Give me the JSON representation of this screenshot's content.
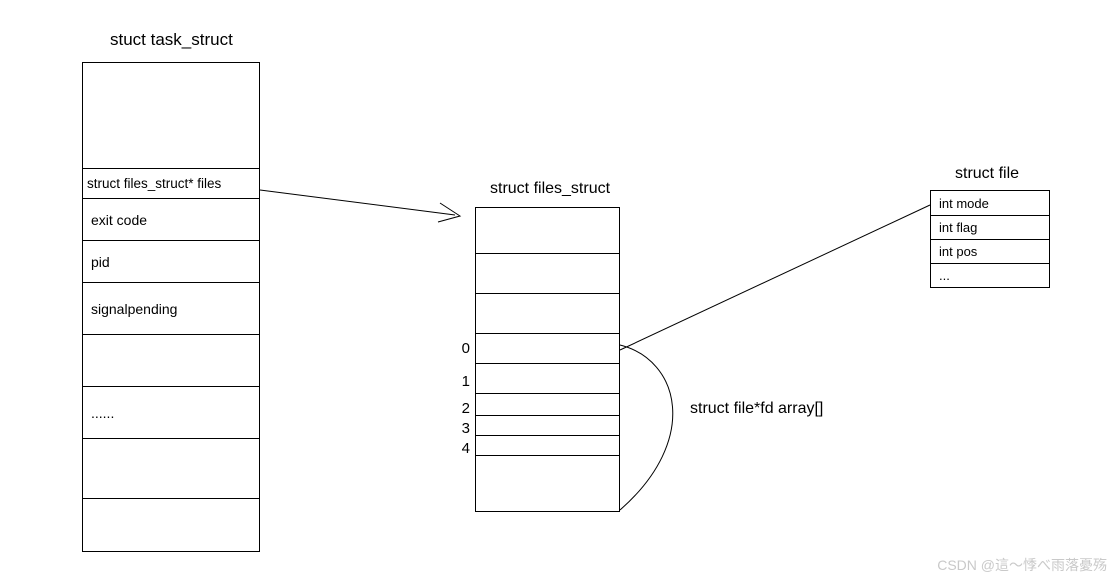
{
  "task_struct": {
    "title": "stuct task_struct",
    "rows": {
      "files": "struct files_struct* files",
      "exit_code": "exit code",
      "pid": "pid",
      "signalpending": "signalpending",
      "rest": "......"
    }
  },
  "files_struct": {
    "title": "struct files_struct",
    "indices": [
      "0",
      "1",
      "2",
      "3",
      "4"
    ],
    "array_label": "struct file*fd array[]"
  },
  "file": {
    "title": "struct file",
    "rows": {
      "mode": "int mode",
      "flag": "int flag",
      "pos": "int pos",
      "rest": "..."
    }
  },
  "watermark": "CSDN @這～悸べ雨落憂殇"
}
